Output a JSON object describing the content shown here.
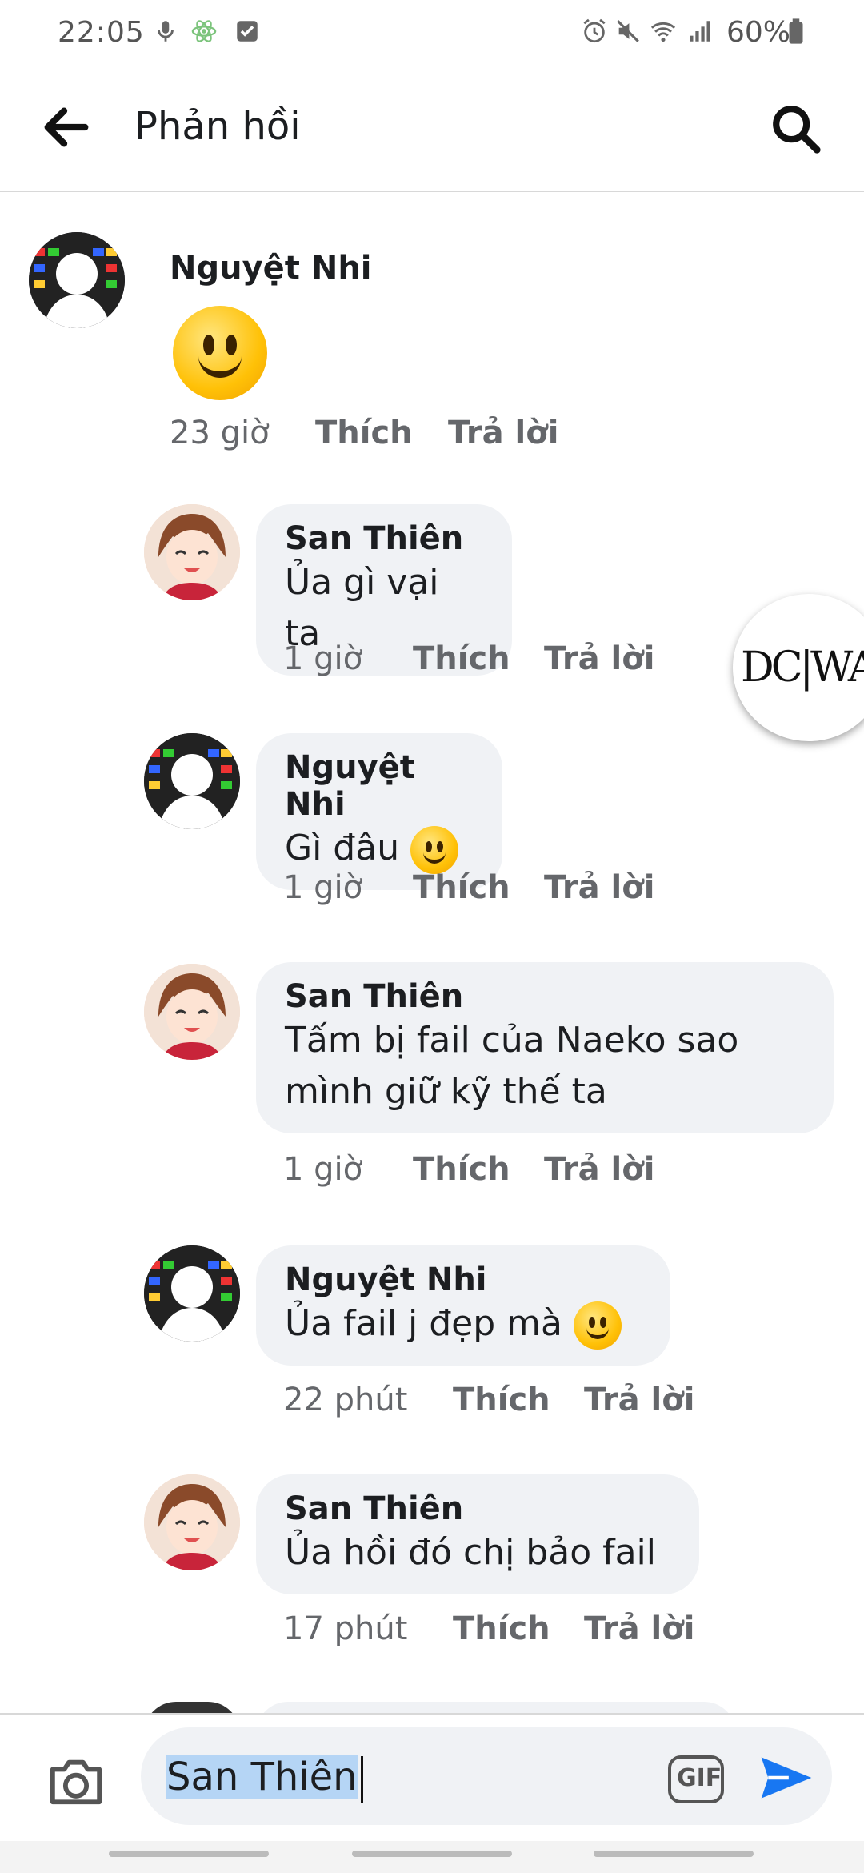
{
  "status_bar": {
    "time": "22:05",
    "battery": "60%"
  },
  "header": {
    "title": "Phản hồi"
  },
  "comments": [
    {
      "author": "Nguyệt Nhi",
      "text": "",
      "time": "23 giờ",
      "like": "Thích",
      "reply": "Trả lời"
    },
    {
      "author": "San Thiên",
      "text": "Ủa gì vại ta",
      "time": "1 giờ",
      "like": "Thích",
      "reply": "Trả lời"
    },
    {
      "author": "Nguyệt Nhi",
      "text": "Gì đâu",
      "time": "1 giờ",
      "like": "Thích",
      "reply": "Trả lời"
    },
    {
      "author": "San Thiên",
      "text_line1": "Tấm bị fail của Naeko sao",
      "text_line2": "mình giữ kỹ thế ta",
      "time": "1 giờ",
      "like": "Thích",
      "reply": "Trả lời"
    },
    {
      "author": "Nguyệt Nhi",
      "text": "Ủa fail j đẹp mà",
      "time": "22 phút",
      "like": "Thích",
      "reply": "Trả lời"
    },
    {
      "author": "San Thiên",
      "text": "Ủa hồi đó chị bảo fail",
      "time": "17 phút",
      "like": "Thích",
      "reply": "Trả lời"
    }
  ],
  "composer": {
    "value": "San Thiên",
    "gif_label": "GIF"
  },
  "icons": {
    "back": "arrow-left-icon",
    "search": "search-icon",
    "camera": "camera-icon",
    "send": "send-icon"
  },
  "colors": {
    "accent": "#1877f2",
    "bubble": "#f0f2f5"
  }
}
